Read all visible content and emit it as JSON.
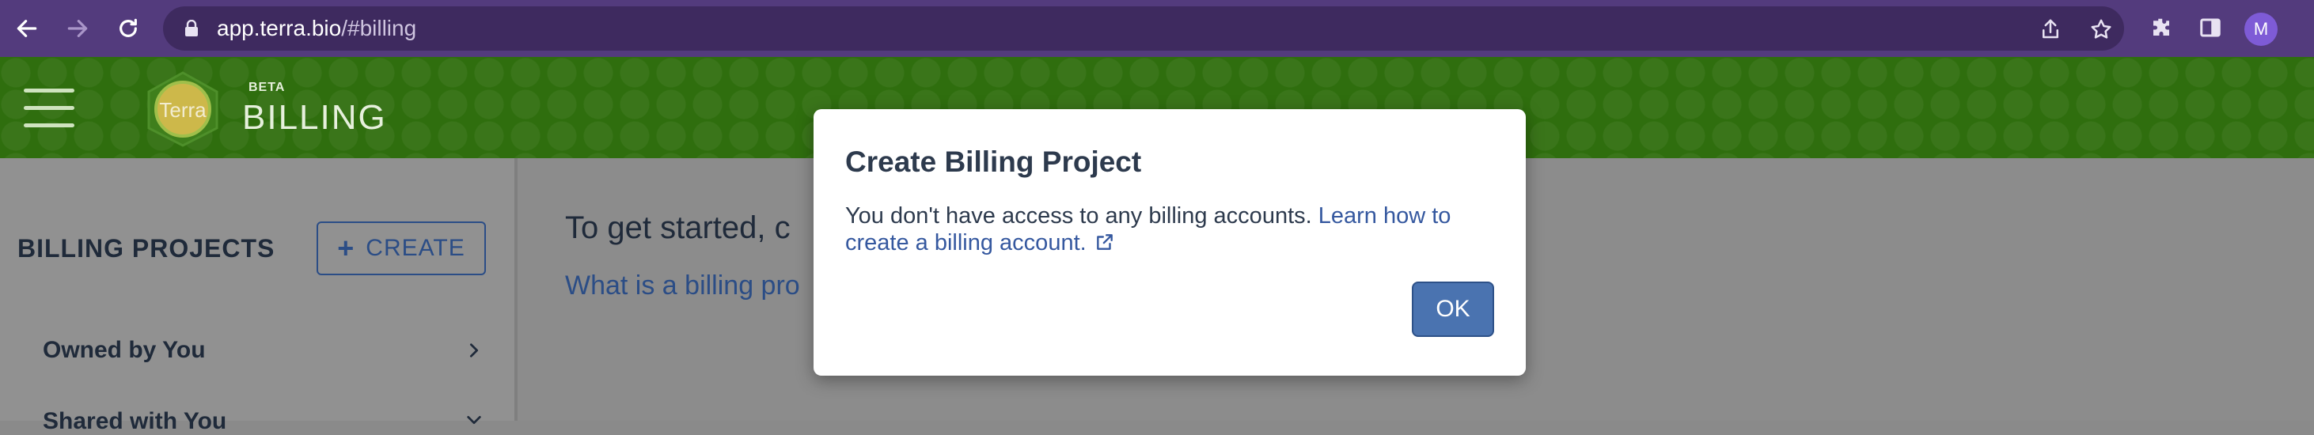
{
  "browser": {
    "url_host": "app.terra.bio",
    "url_path": "/#billing",
    "avatar_letter": "M"
  },
  "header": {
    "beta_label": "BETA",
    "title": "BILLING",
    "logo_text": "Terra"
  },
  "sidebar": {
    "title": "BILLING PROJECTS",
    "create_label": "CREATE",
    "items": [
      {
        "label": "Owned by You"
      },
      {
        "label": "Shared with You"
      }
    ]
  },
  "main": {
    "intro_text": "To get started, c",
    "help_link": "What is a billing pro"
  },
  "modal": {
    "title": "Create Billing Project",
    "body_text": "You don't have access to any billing accounts.",
    "link_text": "Learn how to create a billing account.",
    "ok_label": "OK"
  },
  "colors": {
    "browser_chrome": "#533b7d",
    "header_green": "#2f6e0e",
    "accent_blue": "#4a73b0",
    "link_blue": "#35589f"
  }
}
